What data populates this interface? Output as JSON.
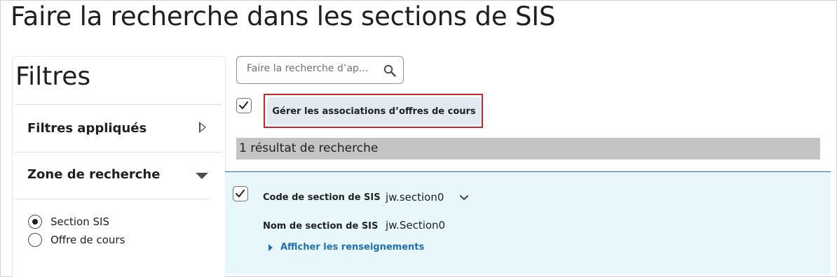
{
  "page": {
    "title": "Faire la recherche dans les sections de SIS"
  },
  "filters": {
    "title": "Filtres",
    "applied_label": "Filtres appliqués",
    "search_area_label": "Zone de recherche",
    "options": [
      {
        "label": "Section SIS",
        "selected": true
      },
      {
        "label": "Offre de cours",
        "selected": false
      }
    ]
  },
  "search": {
    "placeholder": "Faire la recherche d’ap...",
    "icon": "search-icon"
  },
  "toolbar": {
    "select_all_checked": true,
    "manage_button_label": "Gérer les associations d’offres de cours"
  },
  "results": {
    "summary": "1 résultat de recherche",
    "items": [
      {
        "checked": true,
        "code_label": "Code de section de SIS",
        "code_value": "jw.section0",
        "name_label": "Nom de section de SIS",
        "name_value": "jw.Section0",
        "details_link": "Afficher les renseignements"
      }
    ]
  },
  "colors": {
    "accent": "#1f6fb5",
    "highlight": "#c1272d",
    "row_bg": "#e8f7fc",
    "button_bg": "#e3e9f1",
    "results_bar": "#c4c4c4"
  }
}
